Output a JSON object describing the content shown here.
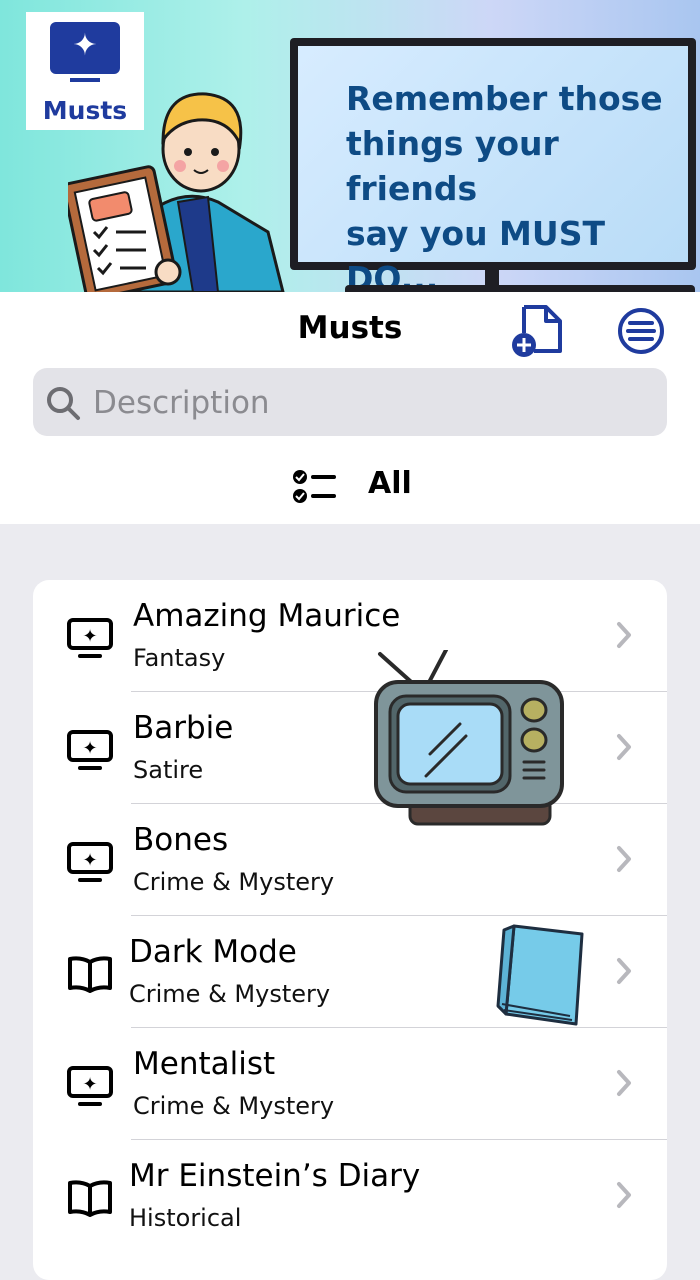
{
  "banner": {
    "logo_label": "Musts",
    "slogan_line1": "Remember those",
    "slogan_line2": "things your friends",
    "slogan_line3": "say you MUST DO..."
  },
  "header": {
    "title": "Musts"
  },
  "search": {
    "placeholder": "Description",
    "value": ""
  },
  "filter": {
    "label": "All"
  },
  "list": {
    "items": [
      {
        "title": "Amazing Maurice",
        "subtitle": "Fantasy",
        "icon": "monitor-sparkle-icon"
      },
      {
        "title": "Barbie",
        "subtitle": "Satire",
        "icon": "monitor-sparkle-icon"
      },
      {
        "title": "Bones",
        "subtitle": "Crime & Mystery",
        "icon": "monitor-sparkle-icon"
      },
      {
        "title": "Dark Mode",
        "subtitle": "Crime & Mystery",
        "icon": "book-icon"
      },
      {
        "title": "Mentalist",
        "subtitle": "Crime & Mystery",
        "icon": "monitor-sparkle-icon"
      },
      {
        "title": "Mr Einstein’s Diary",
        "subtitle": "Historical",
        "icon": "book-icon"
      }
    ]
  },
  "colors": {
    "brand_blue": "#1f3b9e",
    "slogan_blue": "#0e4b85",
    "background": "#ebebf0"
  }
}
